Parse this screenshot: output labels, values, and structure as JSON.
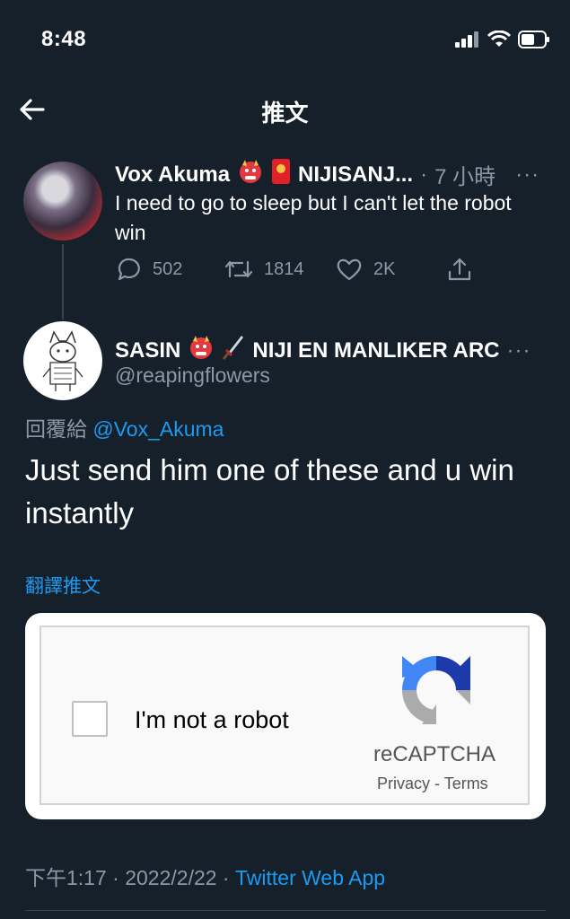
{
  "status_bar": {
    "time": "8:48"
  },
  "header": {
    "title": "推文"
  },
  "parent_tweet": {
    "name": "Vox Akuma",
    "name_suffix": "NIJISANJ...",
    "time_sep": "·",
    "time_ago": "7 小時",
    "more": "···",
    "text": "I need to go to sleep but I can't let the robot win",
    "replies": "502",
    "retweets": "1814",
    "likes": "2K"
  },
  "main_tweet": {
    "name_part1": "SASIN",
    "name_part2": "NIJI EN MANLIKER ARC",
    "more": "···",
    "handle": "@reapingflowers",
    "reply_prefix": "回覆給",
    "reply_to": "@Vox_Akuma",
    "text": "Just send him one of these and u win instantly",
    "translate": "翻譯推文"
  },
  "captcha": {
    "checkbox_label": "I'm not a robot",
    "brand": "reCAPTCHA",
    "privacy": "Privacy",
    "sep": " - ",
    "terms": "Terms"
  },
  "meta": {
    "time": "下午1:17",
    "sep": " · ",
    "date": "2022/2/22",
    "source": "Twitter Web App"
  },
  "colors": {
    "background": "#15202b",
    "accent": "#1d9bf0",
    "muted": "#8b98a5"
  },
  "icons": {
    "back": "arrow-left-icon",
    "reply": "reply-icon",
    "retweet": "retweet-icon",
    "like": "heart-icon",
    "share": "share-icon",
    "emoji_ogre": "japanese-ogre-emoji",
    "emoji_envelope": "red-envelope-emoji",
    "emoji_sword": "dagger-emoji"
  }
}
